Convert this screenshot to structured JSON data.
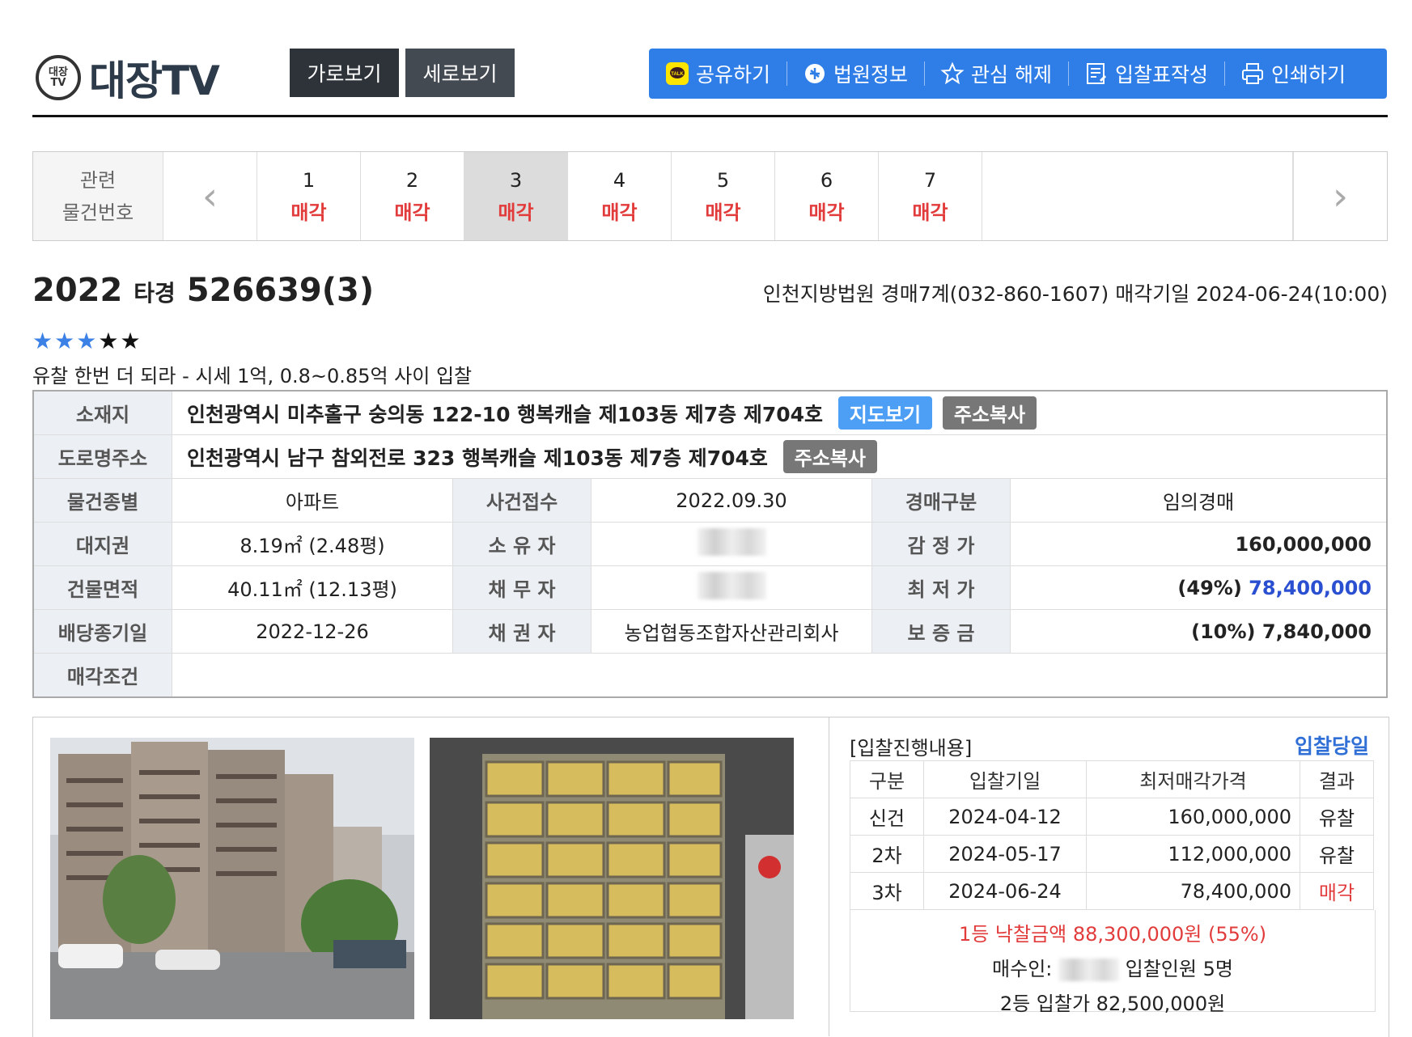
{
  "header": {
    "logo_emblem_top": "대장",
    "logo_emblem_bottom": "TV",
    "logo_text": "대장TV",
    "view_buttons": [
      "가로보기",
      "세로보기"
    ],
    "toolbar": [
      {
        "label": "공유하기",
        "icon": "kakao-talk-icon"
      },
      {
        "label": "법원정보",
        "icon": "court-icon"
      },
      {
        "label": "관심 해제",
        "icon": "star-outline-icon"
      },
      {
        "label": "입찰표작성",
        "icon": "bid-form-icon"
      },
      {
        "label": "인쇄하기",
        "icon": "printer-icon"
      }
    ]
  },
  "related": {
    "label_line1": "관련",
    "label_line2": "물건번호",
    "prev": "‹",
    "next": "›",
    "items": [
      {
        "num": "1",
        "status": "매각"
      },
      {
        "num": "2",
        "status": "매각"
      },
      {
        "num": "3",
        "status": "매각",
        "selected": true
      },
      {
        "num": "4",
        "status": "매각"
      },
      {
        "num": "5",
        "status": "매각"
      },
      {
        "num": "6",
        "status": "매각"
      },
      {
        "num": "7",
        "status": "매각"
      }
    ]
  },
  "case": {
    "year": "2022",
    "type": "타경",
    "number": "526639(3)",
    "court_info": "인천지방법원 경매7계(032-860-1607) 매각기일 2024-06-24(10:00)",
    "rating_on": 3,
    "rating_total": 5,
    "memo": "유찰 한번 더 되라 - 시세 1억, 0.8~0.85억 사이 입찰"
  },
  "info": {
    "location_label": "소재지",
    "location": "인천광역시 미추홀구 숭의동 122-10 행복캐슬 제103동 제7층 제704호",
    "map_button": "지도보기",
    "copy_button": "주소복사",
    "road_label": "도로명주소",
    "road_address": "인천광역시 남구 참외전로 323 행복캐슬 제103동 제7층 제704호",
    "rows": [
      [
        "물건종별",
        "아파트",
        "사건접수",
        "2022.09.30",
        "경매구분",
        "임의경매"
      ],
      [
        "대지권",
        "8.19㎡ (2.48평)",
        "소 유 자",
        "",
        "감 정 가",
        "160,000,000"
      ],
      [
        "건물면적",
        "40.11㎡ (12.13평)",
        "채 무 자",
        "",
        "최 저 가",
        "78,400,000"
      ],
      [
        "배당종기일",
        "2022-12-26",
        "채 권 자",
        "농업협동조합자산관리회사",
        "보 증 금",
        "(10%) 7,840,000"
      ]
    ],
    "min_price_pct": "(49%)",
    "sale_condition_label": "매각조건",
    "sale_condition": ""
  },
  "bid": {
    "title": "[입찰진행내용]",
    "day_link": "입찰당일",
    "headers": [
      "구분",
      "입찰기일",
      "최저매각가격",
      "결과"
    ],
    "rows": [
      [
        "신건",
        "2024-04-12",
        "160,000,000",
        "유찰"
      ],
      [
        "2차",
        "2024-05-17",
        "112,000,000",
        "유찰"
      ],
      [
        "3차",
        "2024-06-24",
        "78,400,000",
        "매각"
      ]
    ],
    "winning": "1등 낙찰금액 88,300,000원 (55%)",
    "buyer_label": "매수인:",
    "bidders": "입찰인원 5명",
    "second": "2등 입찰가 82,500,000원"
  },
  "colors": {
    "accent": "#2f7ee8",
    "sold": "#e23b3b",
    "price": "#2a4fd0"
  }
}
